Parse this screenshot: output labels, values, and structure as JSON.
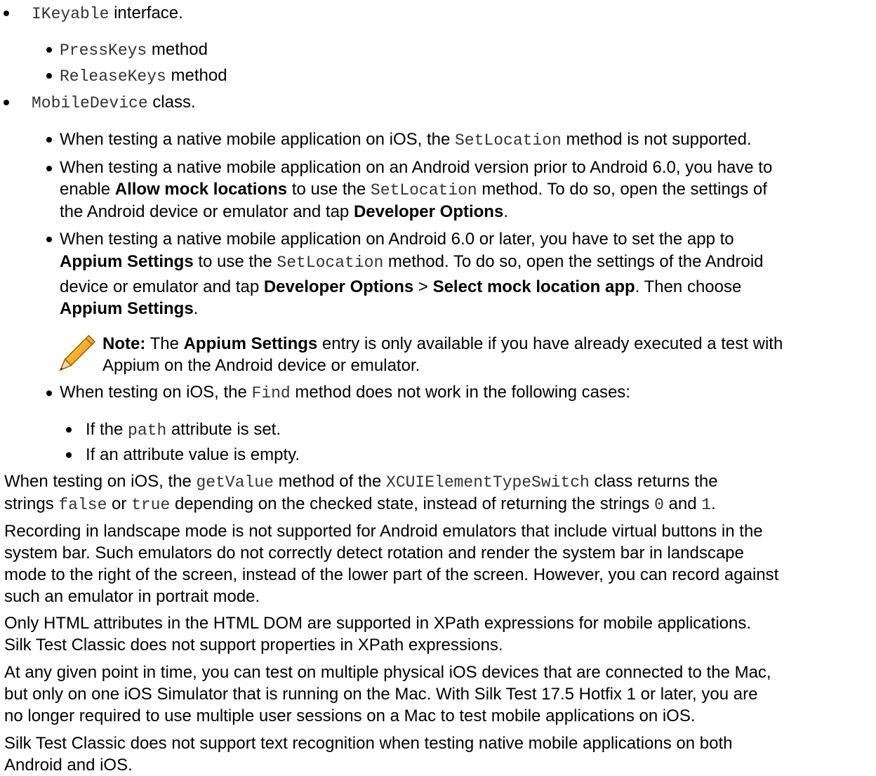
{
  "top_list": {
    "ikeyable": {
      "code": "IKeyable",
      "text": " interface."
    },
    "presskeys": {
      "code": "PressKeys",
      "text": " method"
    },
    "releasekeys": {
      "code": "ReleaseKeys",
      "text": " method"
    },
    "mobiledevice": {
      "code": "MobileDevice",
      "text": " class."
    }
  },
  "mobiledevice_items": {
    "setlocation_ios": {
      "t1": "When testing a native mobile application on iOS, the ",
      "c1": "SetLocation",
      "t2": " method is not supported."
    },
    "setlocation_android_old": {
      "l1": "When testing a native mobile application on an Android version prior to Android 6.0, you have to",
      "l2_t1": "enable ",
      "l2_b1": "Allow mock locations",
      "l2_t2": " to use the ",
      "l2_c1": "SetLocation",
      "l2_t3": " method. To do so, open the settings of",
      "l3_t1": "the Android device or emulator and tap ",
      "l3_b1": "Developer Options",
      "l3_t2": "."
    },
    "setlocation_android_new": {
      "l1": "When testing a native mobile application on Android 6.0 or later, you have to set the app to",
      "l2_b1": "Appium Settings",
      "l2_t1": " to use the ",
      "l2_c1": "SetLocation",
      "l2_t2": " method. To do so, open the settings of the Android",
      "l3_t1": "device or emulator and tap ",
      "l3_b1": "Developer Options",
      "l3_t2": " > ",
      "l3_b2": "Select mock location app",
      "l3_t3": ". Then choose",
      "l4_b1": "Appium Settings",
      "l4_t1": "."
    },
    "note": {
      "label": "Note:",
      "t1": " The ",
      "b1": "Appium Settings",
      "t2": " entry is only available if you have already executed a test with",
      "l2": "Appium on the Android device or emulator."
    },
    "find_ios": {
      "t1": "When testing on iOS, the ",
      "c1": "Find",
      "t2": " method does not work in the following cases:"
    },
    "find_cases": {
      "path": {
        "t1": "If the ",
        "c1": "path",
        "t2": " attribute is set."
      },
      "empty": "If an attribute value is empty."
    }
  },
  "paragraphs": {
    "getvalue": {
      "l1_t1": "When testing on iOS, the ",
      "l1_c1": "getValue",
      "l1_t2": " method of the ",
      "l1_c2": "XCUIElementTypeSwitch",
      "l1_t3": " class returns the",
      "l2_t1": "strings ",
      "l2_c1": "false",
      "l2_t2": " or ",
      "l2_c2": "true",
      "l2_t3": " depending on the checked state, instead of returning the strings ",
      "l2_c3": "0",
      "l2_t4": " and ",
      "l2_c4": "1",
      "l2_t5": "."
    },
    "landscape": [
      "Recording in landscape mode is not supported for Android emulators that include virtual buttons in the",
      "system bar. Such emulators do not correctly detect rotation and render the system bar in landscape",
      "mode to the right of the screen, instead of the lower part of the screen. However, you can record against",
      "such an emulator in portrait mode."
    ],
    "xpath": [
      "Only HTML attributes in the HTML DOM are supported in XPath expressions for mobile applications.",
      "Silk Test Classic does not support properties in XPath expressions."
    ],
    "devices": [
      "At any given point in time, you can test on multiple physical iOS devices that are connected to the Mac,",
      "but only on one iOS Simulator that is running on the Mac. With Silk Test 17.5 Hotfix 1 or later, you are",
      "no longer required to use multiple user sessions on a Mac to test mobile applications on iOS."
    ],
    "text_recognition": [
      "Silk Test Classic does not support text recognition when testing native mobile applications on both",
      "Android and iOS."
    ]
  },
  "icons": {
    "note": "pencil-note-icon"
  }
}
